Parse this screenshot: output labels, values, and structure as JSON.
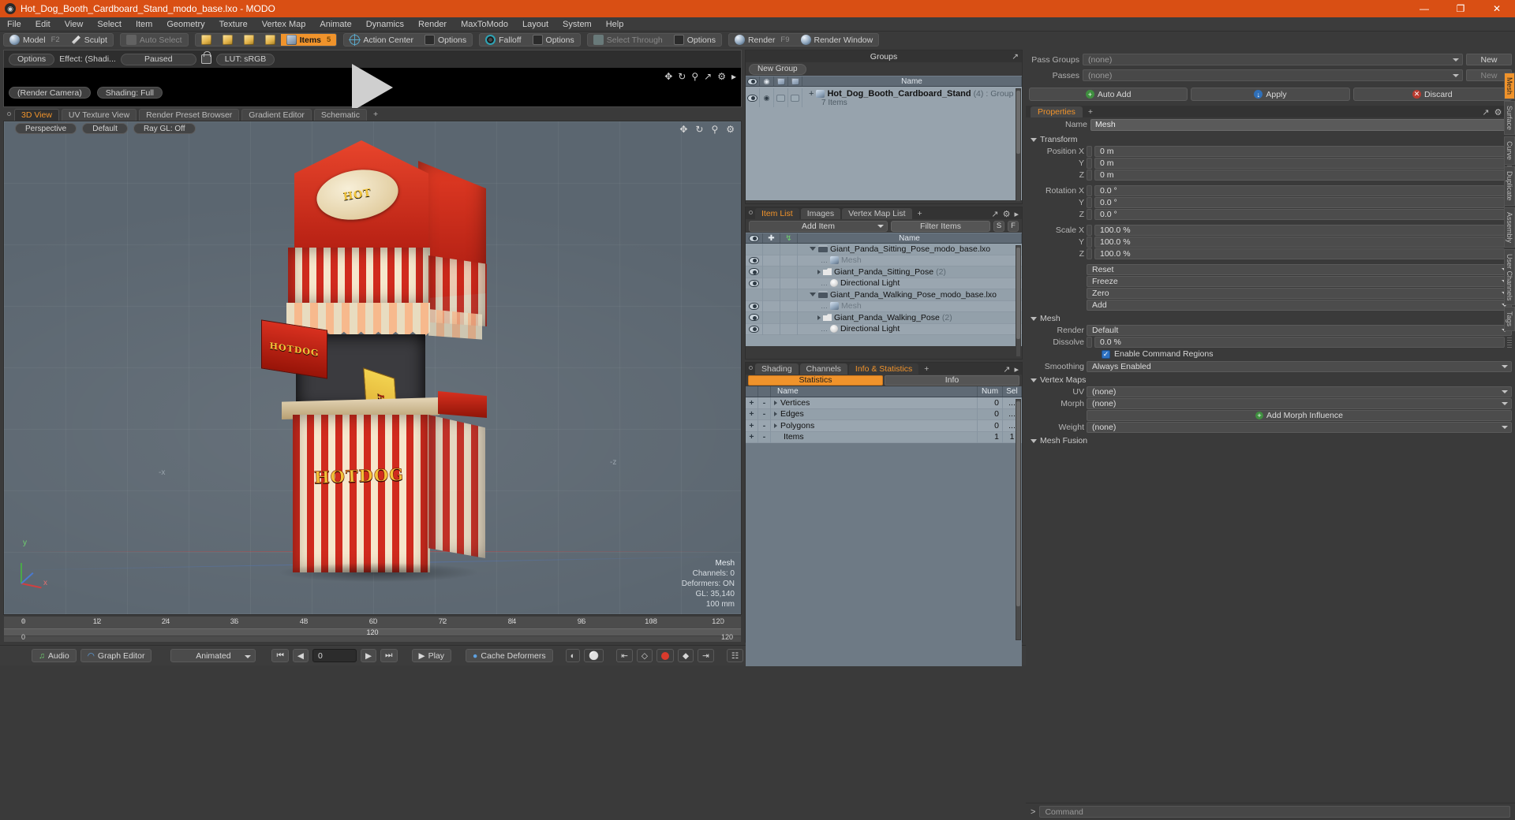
{
  "titlebar": {
    "title": "Hot_Dog_Booth_Cardboard_Stand_modo_base.lxo - MODO",
    "minimize": "—",
    "maximize": "❐",
    "close": "✕"
  },
  "menubar": {
    "items": [
      "File",
      "Edit",
      "View",
      "Select",
      "Item",
      "Geometry",
      "Texture",
      "Vertex Map",
      "Animate",
      "Dynamics",
      "Render",
      "MaxToModo",
      "Layout",
      "System",
      "Help"
    ]
  },
  "modebar": {
    "model": "Model",
    "model_key": "F2",
    "sculpt": "Sculpt",
    "auto_select": "Auto Select",
    "items": "Items",
    "items_key": "5",
    "action_center": "Action Center",
    "options1": "Options",
    "falloff": "Falloff",
    "options2": "Options",
    "select_through": "Select Through",
    "options3": "Options",
    "render": "Render",
    "render_key": "F9",
    "render_window": "Render Window"
  },
  "preview": {
    "options": "Options",
    "effect": "Effect: (Shadi...",
    "paused": "Paused",
    "lut": "LUT: sRGB",
    "render_camera": "(Render Camera)",
    "shading": "Shading: Full"
  },
  "viewport_tabs": {
    "tabs": [
      "3D View",
      "UV Texture View",
      "Render Preset Browser",
      "Gradient Editor",
      "Schematic"
    ],
    "active": "3D View",
    "plus": "+"
  },
  "viewport": {
    "projection": "Perspective",
    "preset": "Default",
    "raygl": "Ray GL: Off",
    "axis_x": "-x",
    "axis_z": "-z",
    "axis_y": "y",
    "axis_x_small": "x",
    "stats": {
      "title": "Mesh",
      "channels": "Channels: 0",
      "deformers": "Deformers: ON",
      "gl": "GL: 35,140",
      "scale": "100 mm"
    },
    "model_sign_top": "HOT",
    "model_sign_left": "HOTDOG",
    "model_sign_front": "HOTDOG",
    "model_sign_side": "HOT"
  },
  "timeline": {
    "ticks": [
      "0",
      "12",
      "24",
      "36",
      "48",
      "60",
      "72",
      "84",
      "96",
      "108",
      "120"
    ],
    "end_label": "120",
    "sub_start": "0",
    "sub_end": "120"
  },
  "bottombar": {
    "audio": "Audio",
    "graph_editor": "Graph Editor",
    "animated": "Animated",
    "frame_value": "0",
    "play": "Play",
    "cache_deformers": "Cache Deformers",
    "settings": "Settings",
    "first": "⏮",
    "prev": "◀",
    "next": "▶",
    "last": "⏭"
  },
  "groups": {
    "title": "Groups",
    "new_group": "New Group",
    "columns": [
      "eye",
      "cam",
      "shape1",
      "shape2",
      "Name"
    ],
    "name_header": "Name",
    "rows": [
      {
        "name": "Hot_Dog_Booth_Cardboard_Stand",
        "count": "(4)",
        "type": ": Group",
        "sub": "7 Items"
      }
    ]
  },
  "item_list": {
    "tabs": [
      "Item List",
      "Images",
      "Vertex Map List"
    ],
    "active": "Item List",
    "plus": "+",
    "add_item": "Add Item",
    "filter_placeholder": "Filter Items",
    "btn_s": "S",
    "btn_f": "F",
    "name_header": "Name",
    "rows": [
      {
        "name": "Giant_Panda_Sitting_Pose_modo_base.lxo",
        "icon": "film-icon",
        "indent": 0,
        "expander": "down",
        "dim": false,
        "eye": false
      },
      {
        "name": "Mesh",
        "icon": "mesh-icon",
        "indent": 1,
        "expander": "none",
        "dim": true,
        "eye": true
      },
      {
        "name": "Giant_Panda_Sitting_Pose",
        "suffix": "(2)",
        "icon": "pose-icon",
        "indent": 1,
        "expander": "right",
        "dim": false,
        "eye": true
      },
      {
        "name": "Directional Light",
        "icon": "light-icon",
        "indent": 1,
        "expander": "none",
        "dim": false,
        "eye": true
      },
      {
        "name": "Giant_Panda_Walking_Pose_modo_base.lxo",
        "icon": "film-icon",
        "indent": 0,
        "expander": "down",
        "dim": false,
        "eye": false
      },
      {
        "name": "Mesh",
        "icon": "mesh-icon",
        "indent": 1,
        "expander": "none",
        "dim": true,
        "eye": true
      },
      {
        "name": "Giant_Panda_Walking_Pose",
        "suffix": "(2)",
        "icon": "pose-icon",
        "indent": 1,
        "expander": "right",
        "dim": false,
        "eye": true
      },
      {
        "name": "Directional Light",
        "icon": "light-icon",
        "indent": 1,
        "expander": "none",
        "dim": false,
        "eye": true
      }
    ]
  },
  "stats_panel": {
    "tabs": [
      "Shading",
      "Channels",
      "Info & Statistics"
    ],
    "active": "Info & Statistics",
    "plus": "+",
    "statistics_label": "Statistics",
    "info_label": "Info",
    "columns": [
      "Name",
      "Num",
      "Sel"
    ],
    "rows": [
      {
        "name": "Vertices",
        "num": "0",
        "sel": "..."
      },
      {
        "name": "Edges",
        "num": "0",
        "sel": "..."
      },
      {
        "name": "Polygons",
        "num": "0",
        "sel": "..."
      },
      {
        "name": "Items",
        "num": "1",
        "sel": "1"
      }
    ]
  },
  "render_passes": {
    "pass_groups_label": "Pass Groups",
    "pass_groups_value": "(none)",
    "passes_label": "Passes",
    "passes_value": "(none)",
    "new_label": "New",
    "new_label2": "New",
    "auto_add": "Auto Add",
    "apply": "Apply",
    "discard": "Discard"
  },
  "properties": {
    "tab": "Properties",
    "plus": "+",
    "name_label": "Name",
    "name_value": "Mesh",
    "transform": {
      "title": "Transform",
      "position_label": "Position X",
      "position": [
        "0 m",
        "0 m",
        "0 m"
      ],
      "rotation_label": "Rotation X",
      "rotation": [
        "0.0 °",
        "0.0 °",
        "0.0 °"
      ],
      "scale_label": "Scale X",
      "scale": [
        "100.0 %",
        "100.0 %",
        "100.0 %"
      ],
      "axis_y": "Y",
      "axis_z": "Z",
      "reset": "Reset",
      "freeze": "Freeze",
      "zero": "Zero",
      "add": "Add"
    },
    "mesh": {
      "title": "Mesh",
      "render_label": "Render",
      "render_value": "Default",
      "dissolve_label": "Dissolve",
      "dissolve_value": "0.0 %",
      "enable_command_regions": "Enable Command Regions",
      "smoothing_label": "Smoothing",
      "smoothing_value": "Always Enabled"
    },
    "vertex_maps": {
      "title": "Vertex Maps",
      "uv_label": "UV",
      "uv_value": "(none)",
      "morph_label": "Morph",
      "morph_value": "(none)",
      "weight_label": "Weight",
      "weight_value": "(none)",
      "add_morph_influence": "Add Morph Influence"
    },
    "mesh_fusion": {
      "title": "Mesh Fusion"
    }
  },
  "vertical_tabs": [
    "Mesh",
    "Surface",
    "Curve",
    "Duplicate",
    "Assembly",
    "User Channels",
    "Tags"
  ],
  "vertical_active": "Mesh",
  "command": {
    "prompt": ">",
    "placeholder": "Command"
  },
  "colors": {
    "accent": "#f0932b",
    "titlebar": "#d94f14",
    "panel_bg": "#3a3a3a",
    "list_bg": "#97a3ad",
    "viewport_bg": "#5b6670",
    "model_red": "#d12b1e",
    "model_cream": "#f6e7cc",
    "sign_yellow": "#f3c53a"
  }
}
